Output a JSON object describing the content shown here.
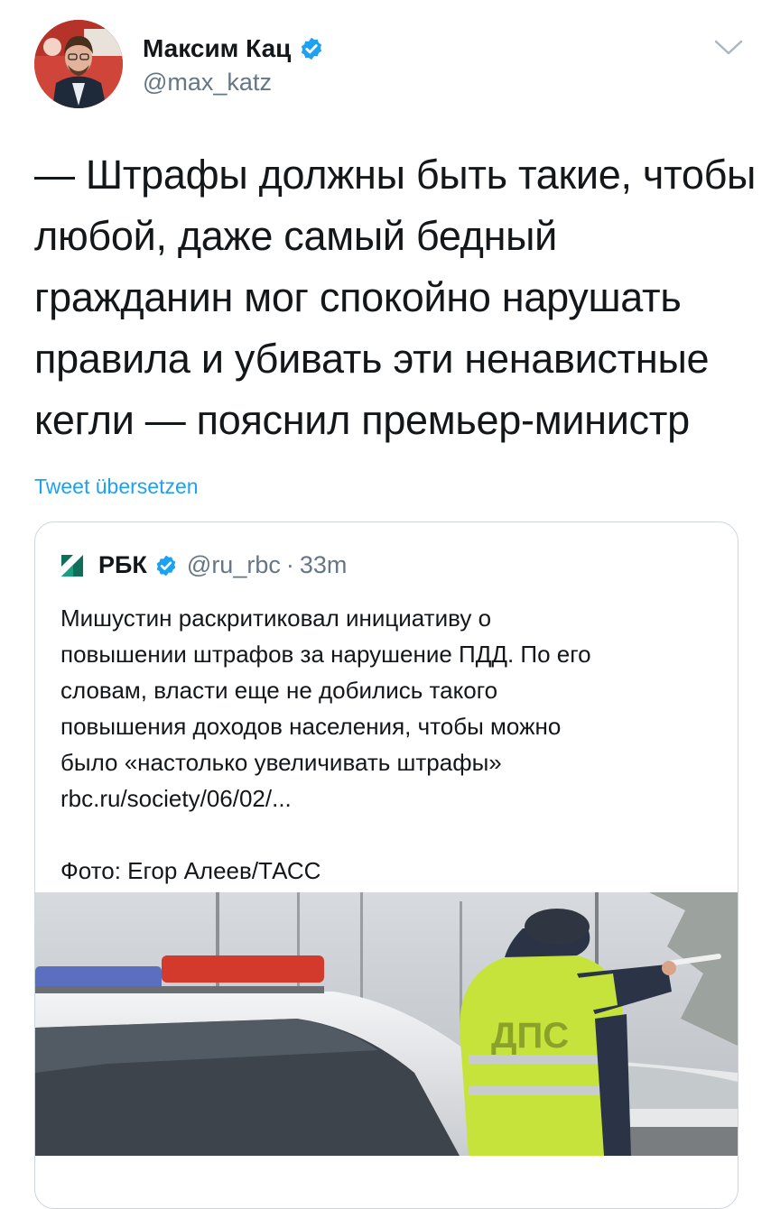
{
  "author": {
    "name": "Максим Кац",
    "handle": "@max_katz"
  },
  "tweet": {
    "lines": [
      "— Штрафы должны быть такие, чтобы",
      "любой, даже самый бедный",
      "гражданин мог спокойно нарушать",
      "правила и убивать эти ненавистные",
      "кегли — пояснил премьер-министр"
    ],
    "translate_label": "Tweet übersetzen"
  },
  "quote": {
    "name": "РБК",
    "handle": "@ru_rbc",
    "separator": "·",
    "time": "33m",
    "lines": [
      "Мишустин раскритиковал инициативу о",
      "повышении штрафов за нарушение ПДД. По его",
      "словам, власти еще не добились такого",
      "повышения доходов населения, чтобы можно",
      "было «настолько увеличивать штрафы»",
      "rbc.ru/society/06/02/..."
    ],
    "photo_credit": "Фото: Егор Алеев/ТАСС",
    "photo": {
      "vest_text": "ДПС"
    }
  },
  "icons": {
    "verified": "verified-badge-icon",
    "chevron": "chevron-down-icon",
    "rbc_logo": "rbc-logo-icon"
  },
  "colors": {
    "accent": "#1da1f2",
    "secondary_text": "#657786",
    "primary_text": "#14171a",
    "border": "#ccd6dd"
  }
}
